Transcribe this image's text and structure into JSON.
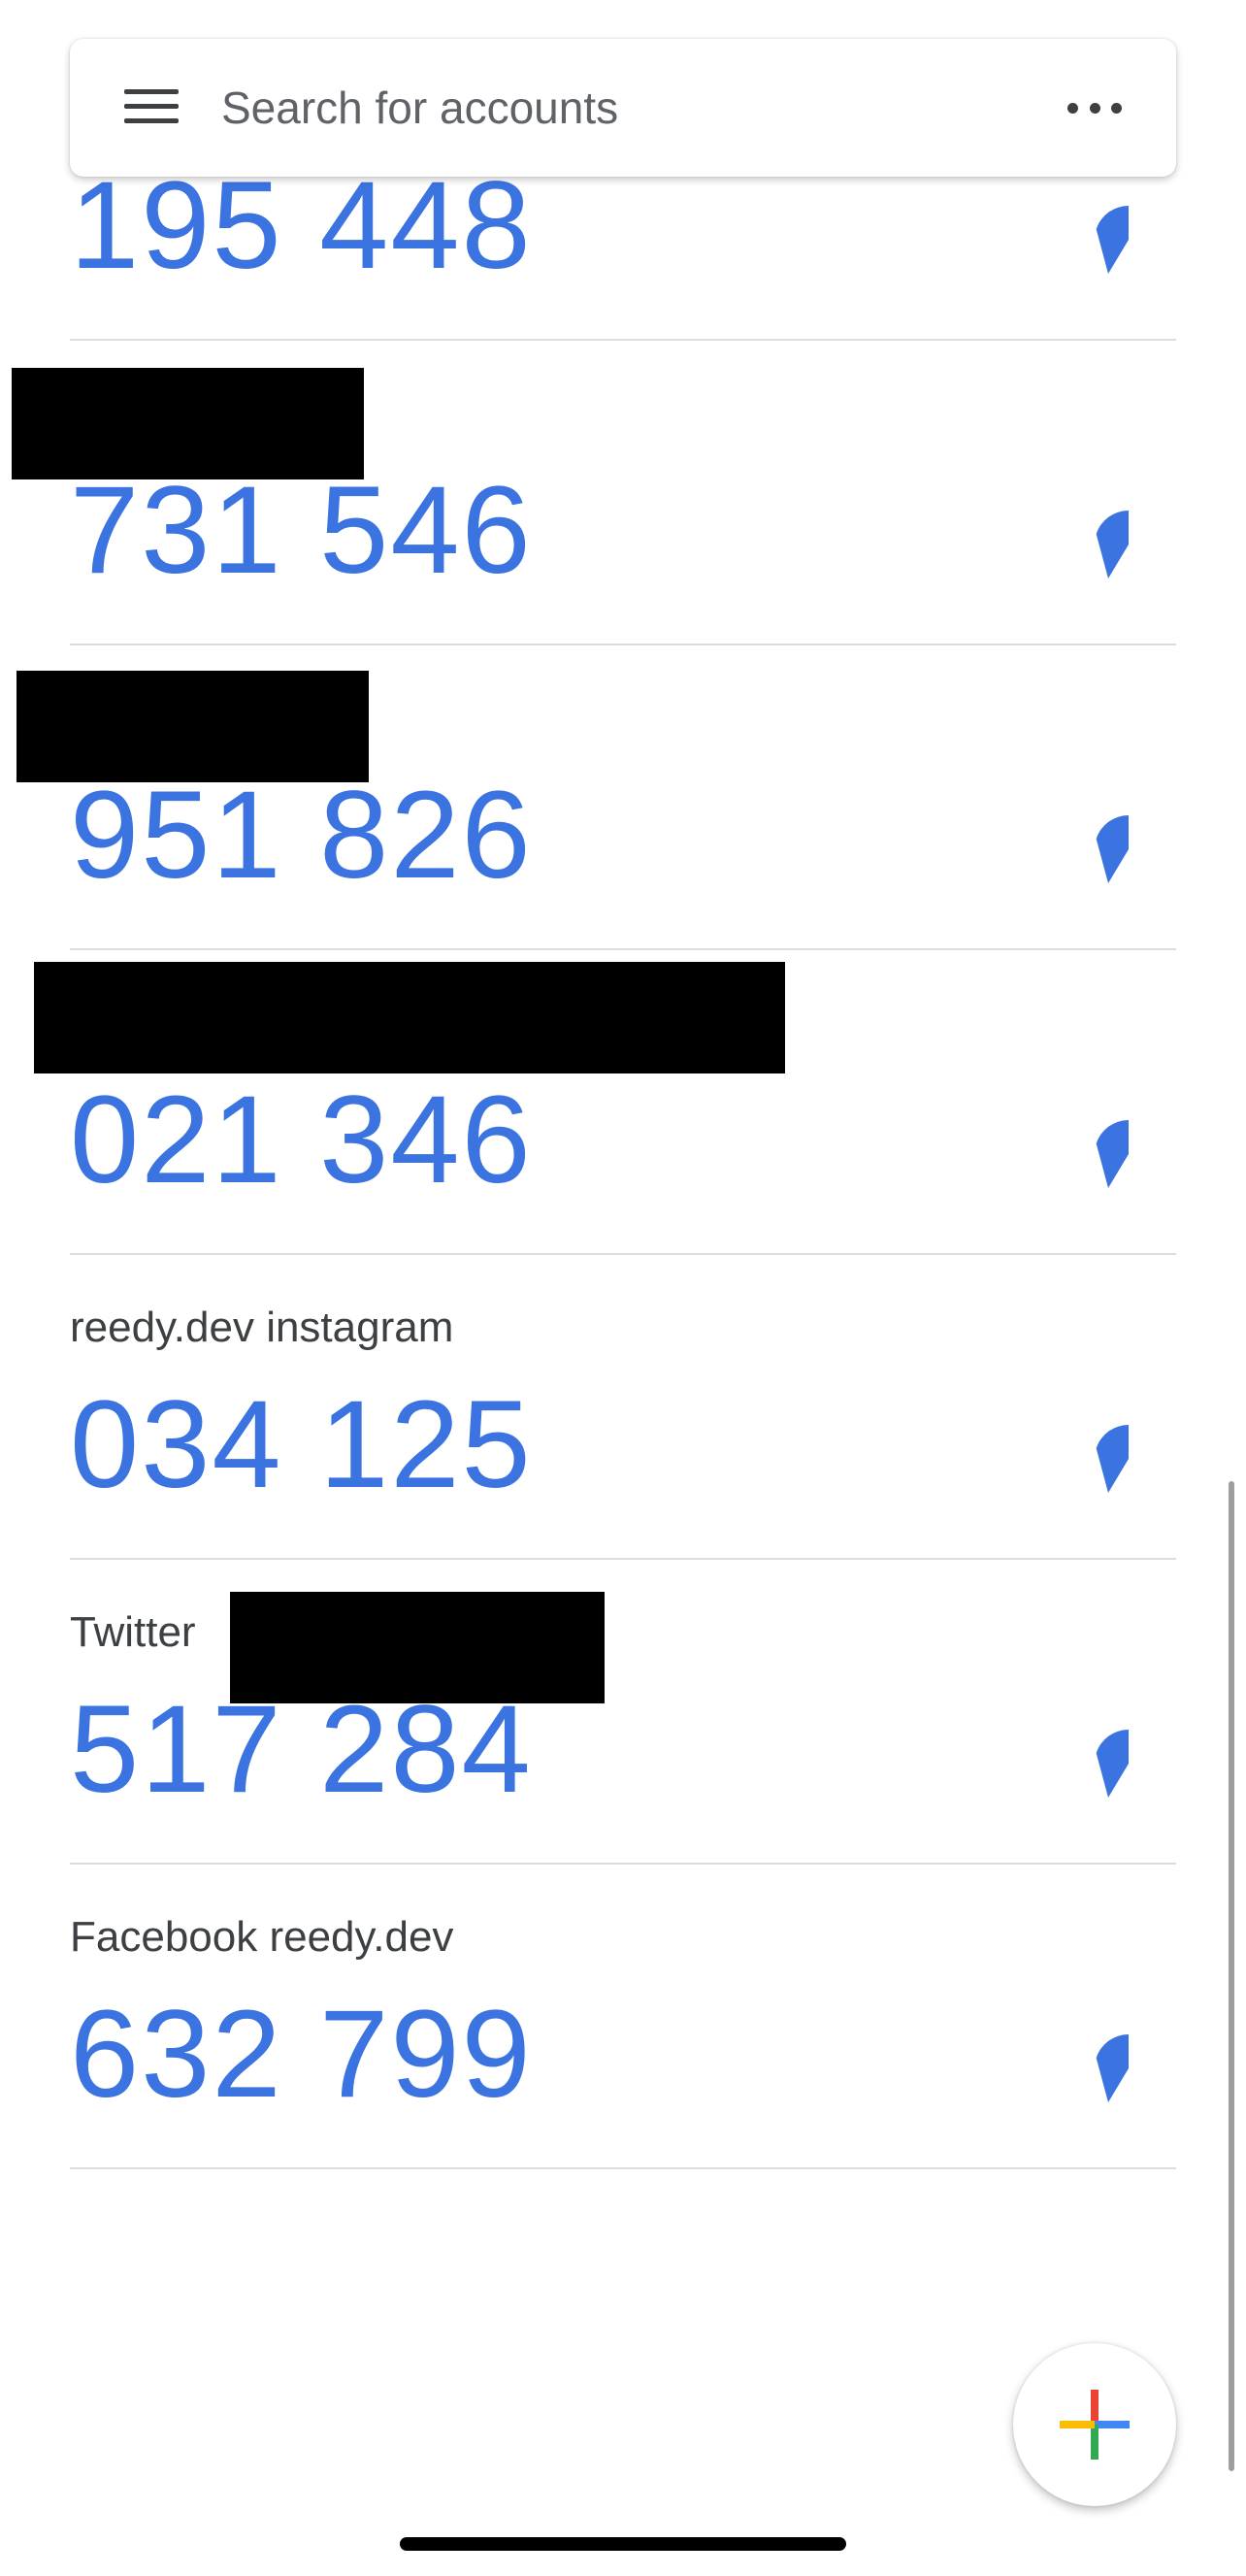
{
  "search": {
    "placeholder": "Search for accounts"
  },
  "accounts": [
    {
      "label": "",
      "code": "195 448"
    },
    {
      "label": "",
      "code": "731 546"
    },
    {
      "label": "",
      "code": "951 826"
    },
    {
      "label": "",
      "code": "021 346"
    },
    {
      "label": "reedy.dev instagram",
      "code": "034 125"
    },
    {
      "label": "Twitter",
      "code": "517 284"
    },
    {
      "label": "Facebook reedy.dev",
      "code": "632 799"
    }
  ],
  "colors": {
    "code": "#3b73e0",
    "timer": "#3b73e0",
    "divider": "#dadce0",
    "fab_plus": [
      "#ea4335",
      "#4285f4",
      "#34a853",
      "#fbbc04"
    ]
  },
  "icons": {
    "menu": "menu-icon",
    "more": "more-vert-icon",
    "timer": "countdown-timer-icon",
    "fab": "add-icon"
  }
}
